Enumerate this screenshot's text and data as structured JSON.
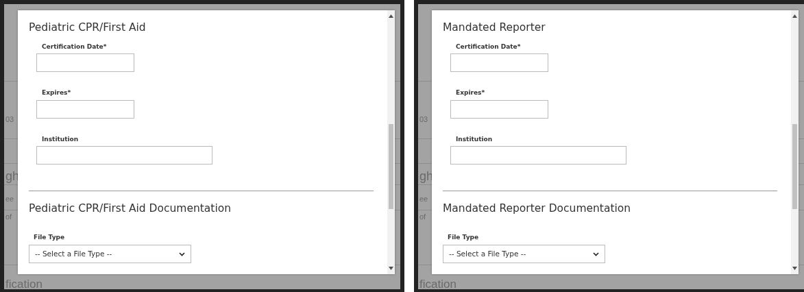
{
  "panels": [
    {
      "background_fragments": [
        {
          "kind": "small",
          "text": "03"
        },
        {
          "kind": "large",
          "text": "gh"
        },
        {
          "kind": "small",
          "text": "ee"
        },
        {
          "kind": "small",
          "text": "of"
        },
        {
          "kind": "bottom",
          "text": "fication"
        }
      ],
      "section_title": "Pediatric CPR/First Aid",
      "fields": [
        {
          "label": "Certification Date*",
          "kind": "short"
        },
        {
          "label": "Expires*",
          "kind": "short"
        },
        {
          "label": "Institution",
          "kind": "wide"
        }
      ],
      "documentation_title": "Pediatric CPR/First Aid Documentation",
      "file_type": {
        "label": "File Type",
        "value": "-- Select a File Type --"
      }
    },
    {
      "background_fragments": [
        {
          "kind": "small",
          "text": "03"
        },
        {
          "kind": "large",
          "text": "gh"
        },
        {
          "kind": "small",
          "text": "ee"
        },
        {
          "kind": "small",
          "text": "of"
        },
        {
          "kind": "bottom",
          "text": "fication"
        }
      ],
      "section_title": "Mandated Reporter",
      "fields": [
        {
          "label": "Certification Date*",
          "kind": "short"
        },
        {
          "label": "Expires*",
          "kind": "short"
        },
        {
          "label": "Institution",
          "kind": "wide"
        }
      ],
      "documentation_title": "Mandated Reporter Documentation",
      "file_type": {
        "label": "File Type",
        "value": "-- Select a File Type --"
      }
    }
  ]
}
